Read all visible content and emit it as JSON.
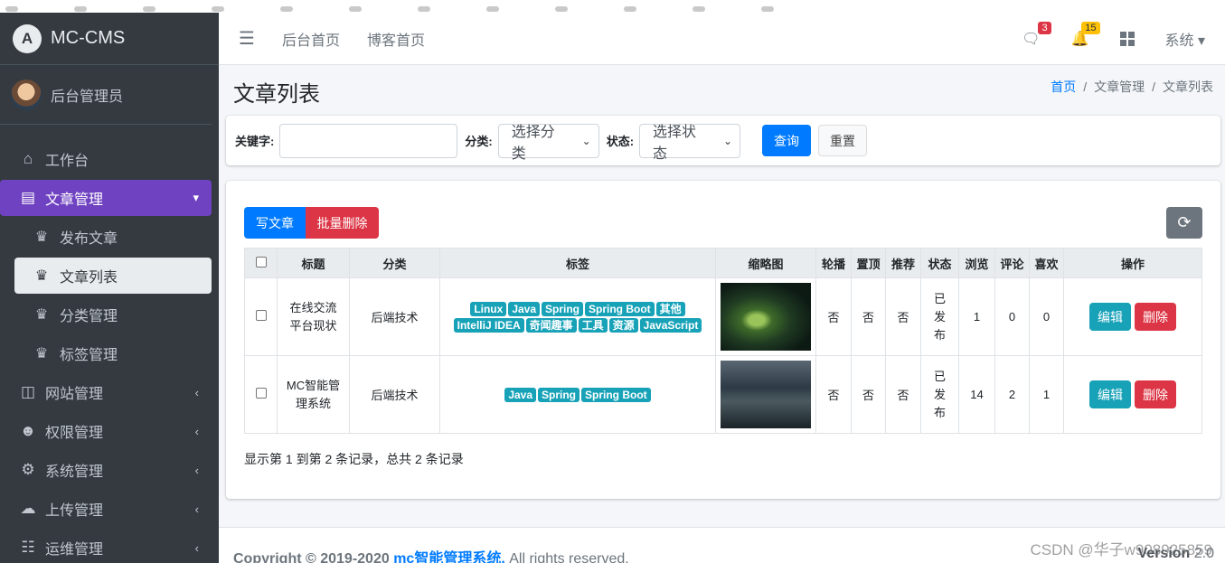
{
  "app": {
    "name": "MC-CMS",
    "user": "后台管理员"
  },
  "sidebar": {
    "items": [
      {
        "label": "工作台",
        "icon": "home-icon"
      },
      {
        "label": "文章管理",
        "icon": "list-icon"
      },
      {
        "label": "网站管理",
        "icon": "columns-icon"
      },
      {
        "label": "权限管理",
        "icon": "users-cog-icon"
      },
      {
        "label": "系统管理",
        "icon": "gear-icon"
      },
      {
        "label": "上传管理",
        "icon": "cloud-upload-icon"
      },
      {
        "label": "运维管理",
        "icon": "sliders-icon"
      }
    ],
    "sub_items": [
      {
        "label": "发布文章"
      },
      {
        "label": "文章列表"
      },
      {
        "label": "分类管理"
      },
      {
        "label": "标签管理"
      }
    ]
  },
  "topbar": {
    "links": [
      "后台首页",
      "博客首页"
    ],
    "messages_count": "3",
    "notifications_count": "15",
    "system_label": "系统"
  },
  "page": {
    "title": "文章列表",
    "breadcrumb": [
      "首页",
      "文章管理",
      "文章列表"
    ]
  },
  "search": {
    "keyword_label": "关键字:",
    "keyword_value": "",
    "category_label": "分类:",
    "category_selected": "选择分类",
    "status_label": "状态:",
    "status_selected": "选择状态",
    "query_button": "查询",
    "reset_button": "重置"
  },
  "toolbar": {
    "write_button": "写文章",
    "batch_delete_button": "批量删除"
  },
  "table": {
    "headers": [
      "标题",
      "分类",
      "标签",
      "缩略图",
      "轮播",
      "置顶",
      "推荐",
      "状态",
      "浏览",
      "评论",
      "喜欢",
      "操作"
    ],
    "rows": [
      {
        "title": "在线交流平台现状",
        "category": "后端技术",
        "tags": [
          "Linux",
          "Java",
          "Spring",
          "Spring Boot",
          "其他",
          "IntelliJ IDEA",
          "奇闻趣事",
          "工具",
          "资源",
          "JavaScript"
        ],
        "carousel": "否",
        "top": "否",
        "recommend": "否",
        "status": "已发布",
        "views": "1",
        "comments": "0",
        "likes": "0"
      },
      {
        "title": "MC智能管理系统",
        "category": "后端技术",
        "tags": [
          "Java",
          "Spring",
          "Spring Boot"
        ],
        "carousel": "否",
        "top": "否",
        "recommend": "否",
        "status": "已发布",
        "views": "14",
        "comments": "2",
        "likes": "1"
      }
    ],
    "edit_label": "编辑",
    "delete_label": "删除",
    "summary": "显示第 1 到第 2 条记录，总共 2 条记录"
  },
  "footer": {
    "copyright_prefix": "Copyright © 2019-2020 ",
    "copyright_link": "mc智能管理系统.",
    "copyright_suffix": " All rights reserved.",
    "version_label": "Version",
    "version_value": " 2.0"
  },
  "watermark": "CSDN @华子w908925859",
  "colors": {
    "accent": "#6f42c1",
    "primary": "#007bff",
    "danger": "#dc3545",
    "info": "#17a2b8",
    "sidebar": "#343a40"
  }
}
